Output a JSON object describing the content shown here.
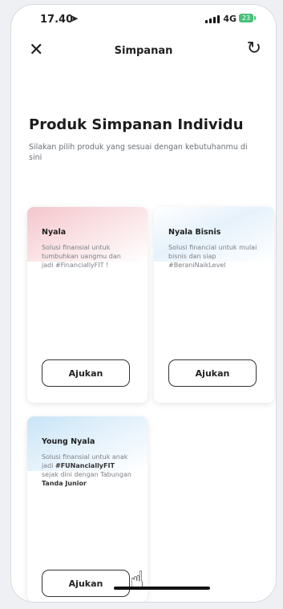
{
  "status": {
    "time": "17.40",
    "location_icon": "location-arrow-icon",
    "network": "4G",
    "battery": "23"
  },
  "header": {
    "title": "Simpanan",
    "close_icon": "close-icon",
    "refresh_icon": "refresh-icon"
  },
  "main": {
    "heading": "Produk Simpanan Individu",
    "subtitle": "Silakan pilih produk yang sesuai dengan kebutuhanmu di sini"
  },
  "cards": [
    {
      "name": "Nyala",
      "desc": "Solusi finansial untuk tumbuhkan uangmu dan jadi #FinanciallyFIT !",
      "button": "Ajukan",
      "accent": "#f6d2d6"
    },
    {
      "name": "Nyala Bisnis",
      "desc": "Solusi financial untuk mulai bisnis dan siap #BeraniNaikLevel",
      "button": "Ajukan",
      "accent": "#e2f0fb"
    },
    {
      "name": "Young Nyala",
      "desc_part1": "Solusi finansial untuk anak jadi",
      "desc_bold1": "#FUNanciallyFIT",
      "desc_part2": "sejak dini dengan Tabungan",
      "desc_bold2": "Tanda Junior",
      "button": "Ajukan",
      "accent": "#d8ecf9"
    }
  ]
}
